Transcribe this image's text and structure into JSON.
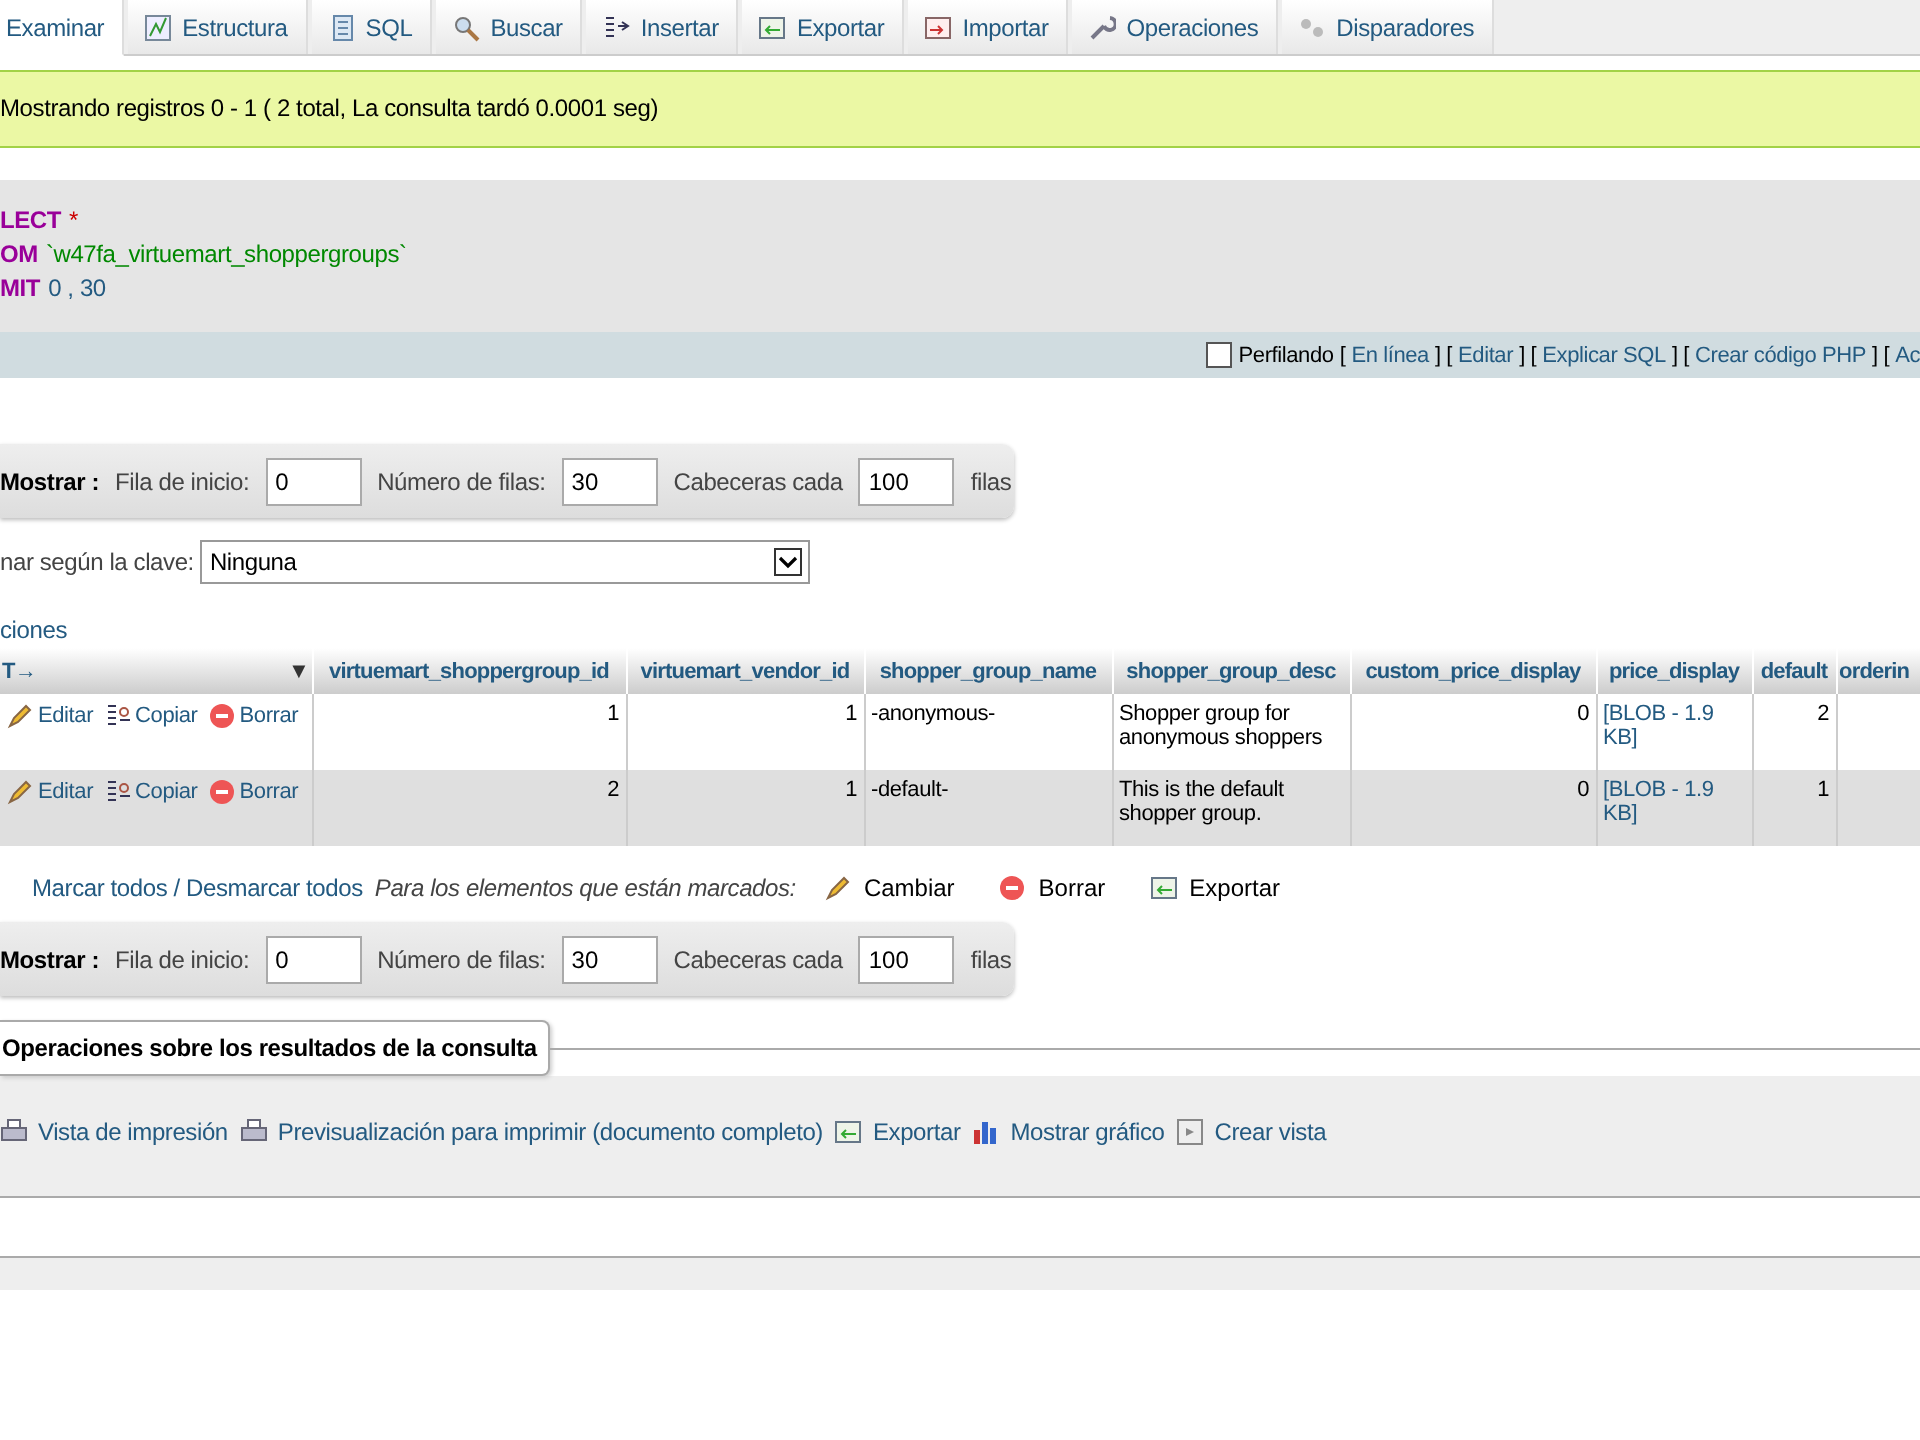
{
  "tabs": [
    {
      "label": "Examinar",
      "selected": true
    },
    {
      "label": "Estructura",
      "selected": false
    },
    {
      "label": "SQL",
      "selected": false
    },
    {
      "label": "Buscar",
      "selected": false
    },
    {
      "label": "Insertar",
      "selected": false
    },
    {
      "label": "Exportar",
      "selected": false
    },
    {
      "label": "Importar",
      "selected": false
    },
    {
      "label": "Operaciones",
      "selected": false
    },
    {
      "label": "Disparadores",
      "selected": false
    }
  ],
  "message": "Mostrando registros 0 - 1 ( 2 total, La consulta tardó 0.0001 seg)",
  "sql": [
    {
      "keyword": "LECT",
      "rest": "*",
      "kind": "star"
    },
    {
      "keyword": "OM",
      "rest": "`w47fa_virtuemart_shoppergroups`",
      "kind": "table"
    },
    {
      "keyword": "MIT",
      "rest": "0 , 30",
      "kind": "number"
    }
  ],
  "query_bar": {
    "profiling": {
      "label": "Perfilando",
      "checked": false
    },
    "items": [
      {
        "kind": "text",
        "text": "["
      },
      {
        "kind": "link",
        "text": "En línea"
      },
      {
        "kind": "text",
        "text": "] ["
      },
      {
        "kind": "link",
        "text": "Editar"
      },
      {
        "kind": "text",
        "text": "] ["
      },
      {
        "kind": "link",
        "text": "Explicar SQL"
      },
      {
        "kind": "text",
        "text": "] ["
      },
      {
        "kind": "link",
        "text": "Crear código PHP"
      },
      {
        "kind": "text",
        "text": "] ["
      },
      {
        "kind": "link",
        "text": "Ac"
      }
    ]
  },
  "navigation": [
    {
      "label": "Mostrar :",
      "start_label": "Fila de inicio:",
      "start": "0",
      "rows_label": "Número de filas:",
      "rows": "30",
      "headers_label": "Cabeceras cada",
      "headers": "100",
      "suffix": "filas"
    },
    {
      "label": "Mostrar :",
      "start_label": "Fila de inicio:",
      "start": "0",
      "rows_label": "Número de filas:",
      "rows": "30",
      "headers_label": "Cabeceras cada",
      "headers": "100",
      "suffix": "filas"
    }
  ],
  "sort": {
    "label": "nar según la clave:",
    "value": "Ninguna"
  },
  "options_link": "ciones",
  "table": {
    "first_header": "T→",
    "sort_marker": "▼",
    "columns": [
      "virtuemart_shoppergroup_id",
      "virtuemart_vendor_id",
      "shopper_group_name",
      "shopper_group_desc",
      "custom_price_display",
      "price_display",
      "default",
      "orderin"
    ],
    "rows": [
      {
        "actions": [
          "Editar",
          "Copiar",
          "Borrar"
        ],
        "cells": [
          "1",
          "1",
          "-anonymous-",
          "Shopper group for anonymous shoppers",
          "0",
          "[BLOB - 1.9 KB]",
          "2",
          ""
        ]
      },
      {
        "actions": [
          "Editar",
          "Copiar",
          "Borrar"
        ],
        "cells": [
          "2",
          "1",
          "-default-",
          "This is the default shopper group.",
          "0",
          "[BLOB - 1.9 KB]",
          "1",
          ""
        ]
      }
    ]
  },
  "bulk": {
    "check_all": "Marcar todos / Desmarcar todos",
    "with_selected": "Para los elementos que están marcados:",
    "actions": [
      "Cambiar",
      "Borrar",
      "Exportar"
    ]
  },
  "query_ops": {
    "legend": "Operaciones sobre los resultados de la consulta",
    "links": [
      "Vista de impresión",
      "Previsualización para imprimir (documento completo)",
      "Exportar",
      "Mostrar gráfico",
      "Crear vista"
    ]
  }
}
